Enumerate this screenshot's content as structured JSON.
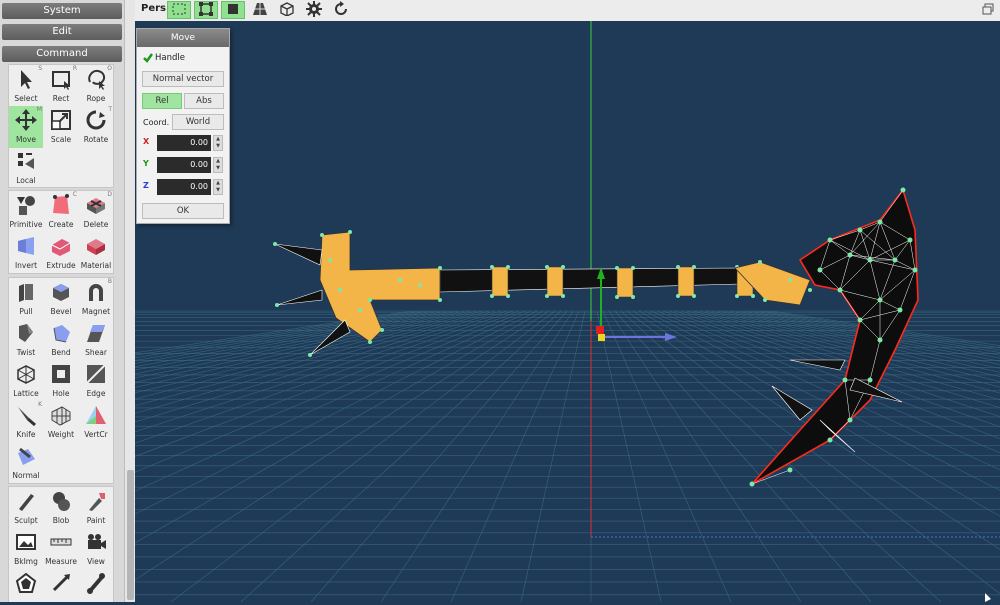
{
  "panel": {
    "system": "System",
    "edit": "Edit",
    "command": "Command"
  },
  "commands": {
    "group1": [
      {
        "label": "Select",
        "icon": "arrow-cursor-icon",
        "key": "S"
      },
      {
        "label": "Rect",
        "icon": "rect-select-icon",
        "key": "R"
      },
      {
        "label": "Rope",
        "icon": "lasso-icon",
        "key": "O"
      },
      {
        "label": "Move",
        "icon": "move-arrows-icon",
        "key": "M",
        "active": true
      },
      {
        "label": "Scale",
        "icon": "scale-icon",
        "key": ""
      },
      {
        "label": "Rotate",
        "icon": "rotate-icon",
        "key": "T"
      },
      {
        "label": "Local",
        "icon": "local-icon",
        "key": ""
      }
    ],
    "group2": [
      {
        "label": "Primitive",
        "icon": "primitive-icon",
        "key": ""
      },
      {
        "label": "Create",
        "icon": "create-icon",
        "key": "C"
      },
      {
        "label": "Delete",
        "icon": "delete-icon",
        "key": "D"
      },
      {
        "label": "Invert",
        "icon": "invert-icon",
        "key": ""
      },
      {
        "label": "Extrude",
        "icon": "extrude-icon",
        "key": ""
      },
      {
        "label": "Material",
        "icon": "material-icon",
        "key": ""
      }
    ],
    "group3": [
      {
        "label": "Pull",
        "icon": "pull-icon",
        "key": ""
      },
      {
        "label": "Bevel",
        "icon": "bevel-icon",
        "key": ""
      },
      {
        "label": "Magnet",
        "icon": "magnet-icon",
        "key": "B"
      },
      {
        "label": "Twist",
        "icon": "twist-icon",
        "key": ""
      },
      {
        "label": "Bend",
        "icon": "bend-icon",
        "key": ""
      },
      {
        "label": "Shear",
        "icon": "shear-icon",
        "key": ""
      },
      {
        "label": "Lattice",
        "icon": "lattice-icon",
        "key": ""
      },
      {
        "label": "Hole",
        "icon": "hole-icon",
        "key": ""
      },
      {
        "label": "Edge",
        "icon": "edge-icon",
        "key": ""
      },
      {
        "label": "Knife",
        "icon": "knife-icon",
        "key": "K"
      },
      {
        "label": "Weight",
        "icon": "weight-icon",
        "key": ""
      },
      {
        "label": "VertCr",
        "icon": "vertex-color-icon",
        "key": ""
      },
      {
        "label": "Normal",
        "icon": "normal-icon",
        "key": ""
      }
    ],
    "group4": [
      {
        "label": "Sculpt",
        "icon": "sculpt-icon",
        "key": ""
      },
      {
        "label": "Blob",
        "icon": "blob-icon",
        "key": ""
      },
      {
        "label": "Paint",
        "icon": "paint-icon",
        "key": ""
      },
      {
        "label": "BkImg",
        "icon": "background-image-icon",
        "key": ""
      },
      {
        "label": "Measure",
        "icon": "measure-icon",
        "key": ""
      },
      {
        "label": "View",
        "icon": "camera-icon",
        "key": ""
      },
      {
        "label": "",
        "icon": "pentagon-icon",
        "key": ""
      },
      {
        "label": "",
        "icon": "bone-arrows-icon",
        "key": ""
      },
      {
        "label": "",
        "icon": "bone-icon",
        "key": ""
      }
    ]
  },
  "toolbar": {
    "view_label": "Pers",
    "buttons": [
      "select-mode-icon",
      "vertex-mode-icon",
      "face-mode-icon",
      "perspective-icon",
      "cube-icon",
      "gear-icon",
      "refresh-icon"
    ]
  },
  "move_dialog": {
    "title": "Move",
    "handle_label": "Handle",
    "handle_checked": true,
    "normal_vector": "Normal vector",
    "rel": "Rel",
    "abs": "Abs",
    "coord_label": "Coord.",
    "coord_value": "World",
    "x_label": "X",
    "y_label": "Y",
    "z_label": "Z",
    "x_value": "0.00",
    "y_value": "0.00",
    "z_value": "0.00",
    "ok": "OK"
  },
  "colors": {
    "viewport_bg": "#1f3a57",
    "accent_green": "#8fe08f",
    "mesh_orange": "#f4b548",
    "vertex_green": "#7ee8a8",
    "edge_red": "#ff2a1a"
  }
}
